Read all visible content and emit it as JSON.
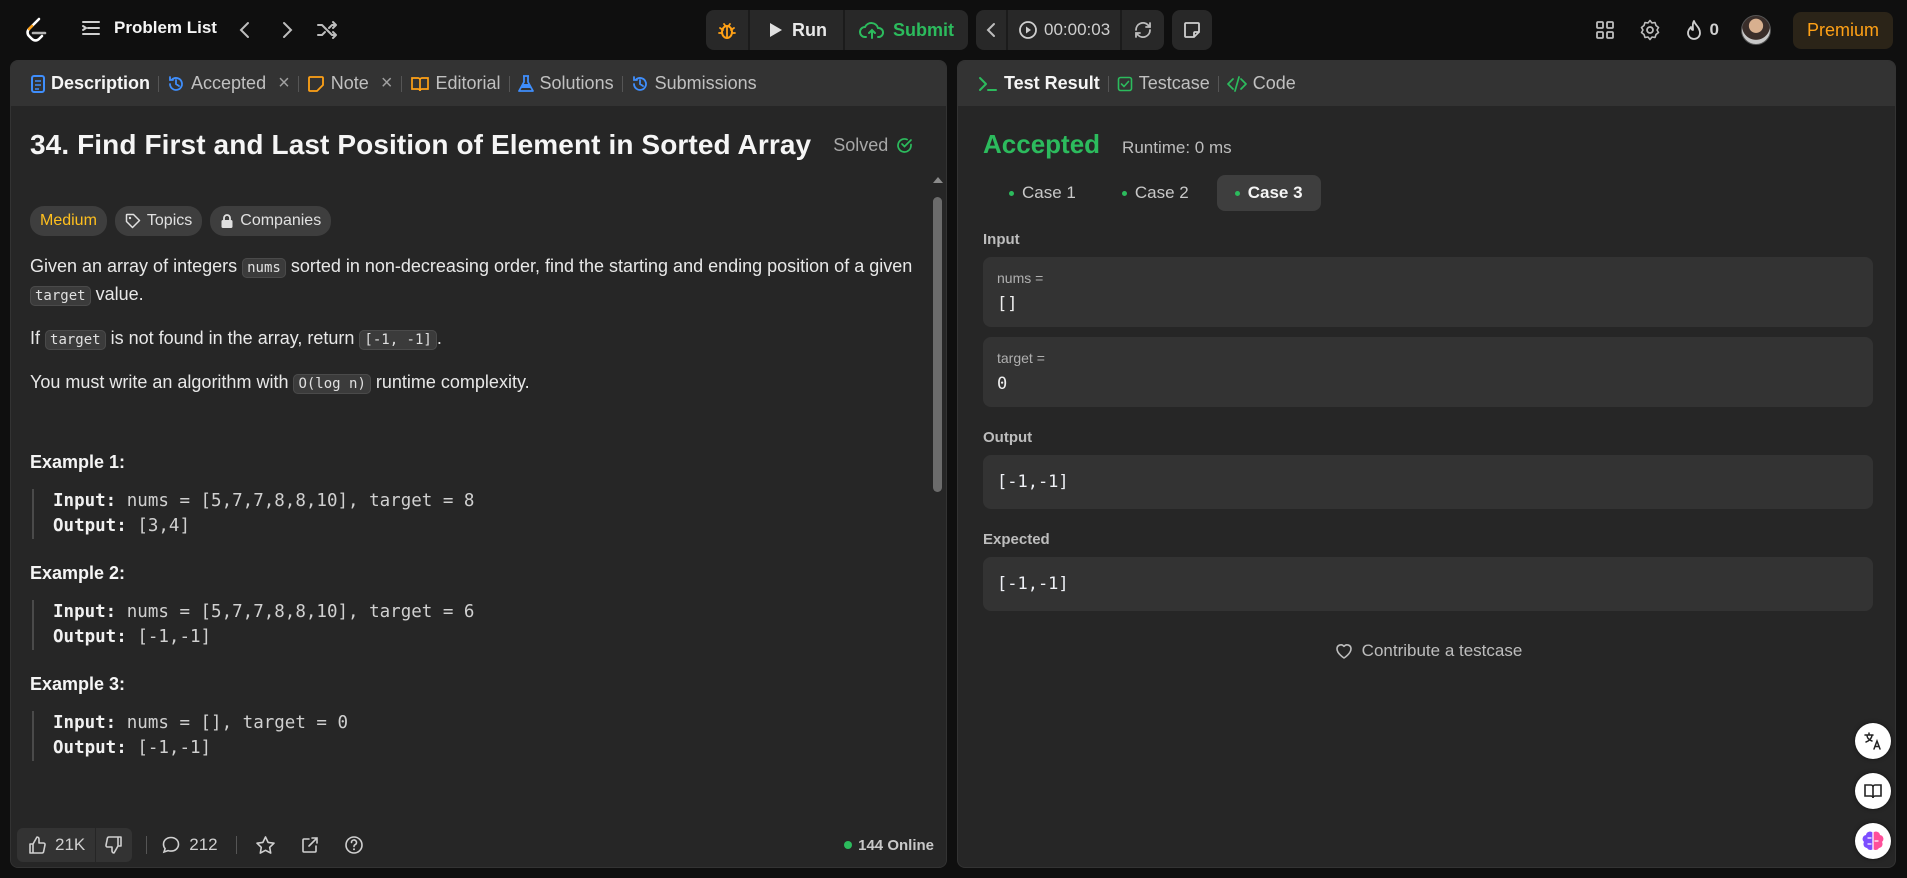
{
  "topbar": {
    "problem_list": "Problem List",
    "run_label": "Run",
    "submit_label": "Submit",
    "timer": "00:00:03",
    "streak_count": "0",
    "premium_label": "Premium"
  },
  "left_tabs": [
    {
      "label": "Description"
    },
    {
      "label": "Accepted"
    },
    {
      "label": "Note"
    },
    {
      "label": "Editorial"
    },
    {
      "label": "Solutions"
    },
    {
      "label": "Submissions"
    }
  ],
  "problem": {
    "title": "34. Find First and Last Position of Element in Sorted Array",
    "status": "Solved",
    "difficulty": "Medium",
    "topics_label": "Topics",
    "companies_label": "Companies",
    "p1_a": "Given an array of integers ",
    "p1_code1": "nums",
    "p1_b": " sorted in non-decreasing order, find the starting and ending position of a given ",
    "p1_code2": "target",
    "p1_c": " value.",
    "p2_a": "If ",
    "p2_code1": "target",
    "p2_b": " is not found in the array, return ",
    "p2_code2": "[-1, -1]",
    "p2_c": ".",
    "p3_a": "You must write an algorithm with ",
    "p3_code1": "O(log n)",
    "p3_b": " runtime complexity.",
    "examples": [
      {
        "title": "Example 1:",
        "input": "nums = [5,7,7,8,8,10], target = 8",
        "output": "[3,4]"
      },
      {
        "title": "Example 2:",
        "input": "nums = [5,7,7,8,8,10], target = 6",
        "output": "[-1,-1]"
      },
      {
        "title": "Example 3:",
        "input": "nums = [], target = 0",
        "output": "[-1,-1]"
      }
    ],
    "input_label": "Input:",
    "output_label": "Output:"
  },
  "bottom": {
    "likes": "21K",
    "comments": "212",
    "online": "144 Online"
  },
  "right_tabs": [
    {
      "label": "Test Result"
    },
    {
      "label": "Testcase"
    },
    {
      "label": "Code"
    }
  ],
  "result": {
    "status": "Accepted",
    "runtime": "Runtime: 0 ms",
    "cases": [
      "Case 1",
      "Case 2",
      "Case 3"
    ],
    "active_case": 2,
    "input_label": "Input",
    "params": [
      {
        "name": "nums =",
        "value": "[]"
      },
      {
        "name": "target =",
        "value": "0"
      }
    ],
    "output_label": "Output",
    "output_value": "[-1,-1]",
    "expected_label": "Expected",
    "expected_value": "[-1,-1]",
    "contribute_label": "Contribute a testcase"
  },
  "colors": {
    "accent_green": "#2cbb5d",
    "medium_yellow": "#ffc01e",
    "premium_orange": "#ffa116",
    "description_blue": "#3f8efc"
  }
}
